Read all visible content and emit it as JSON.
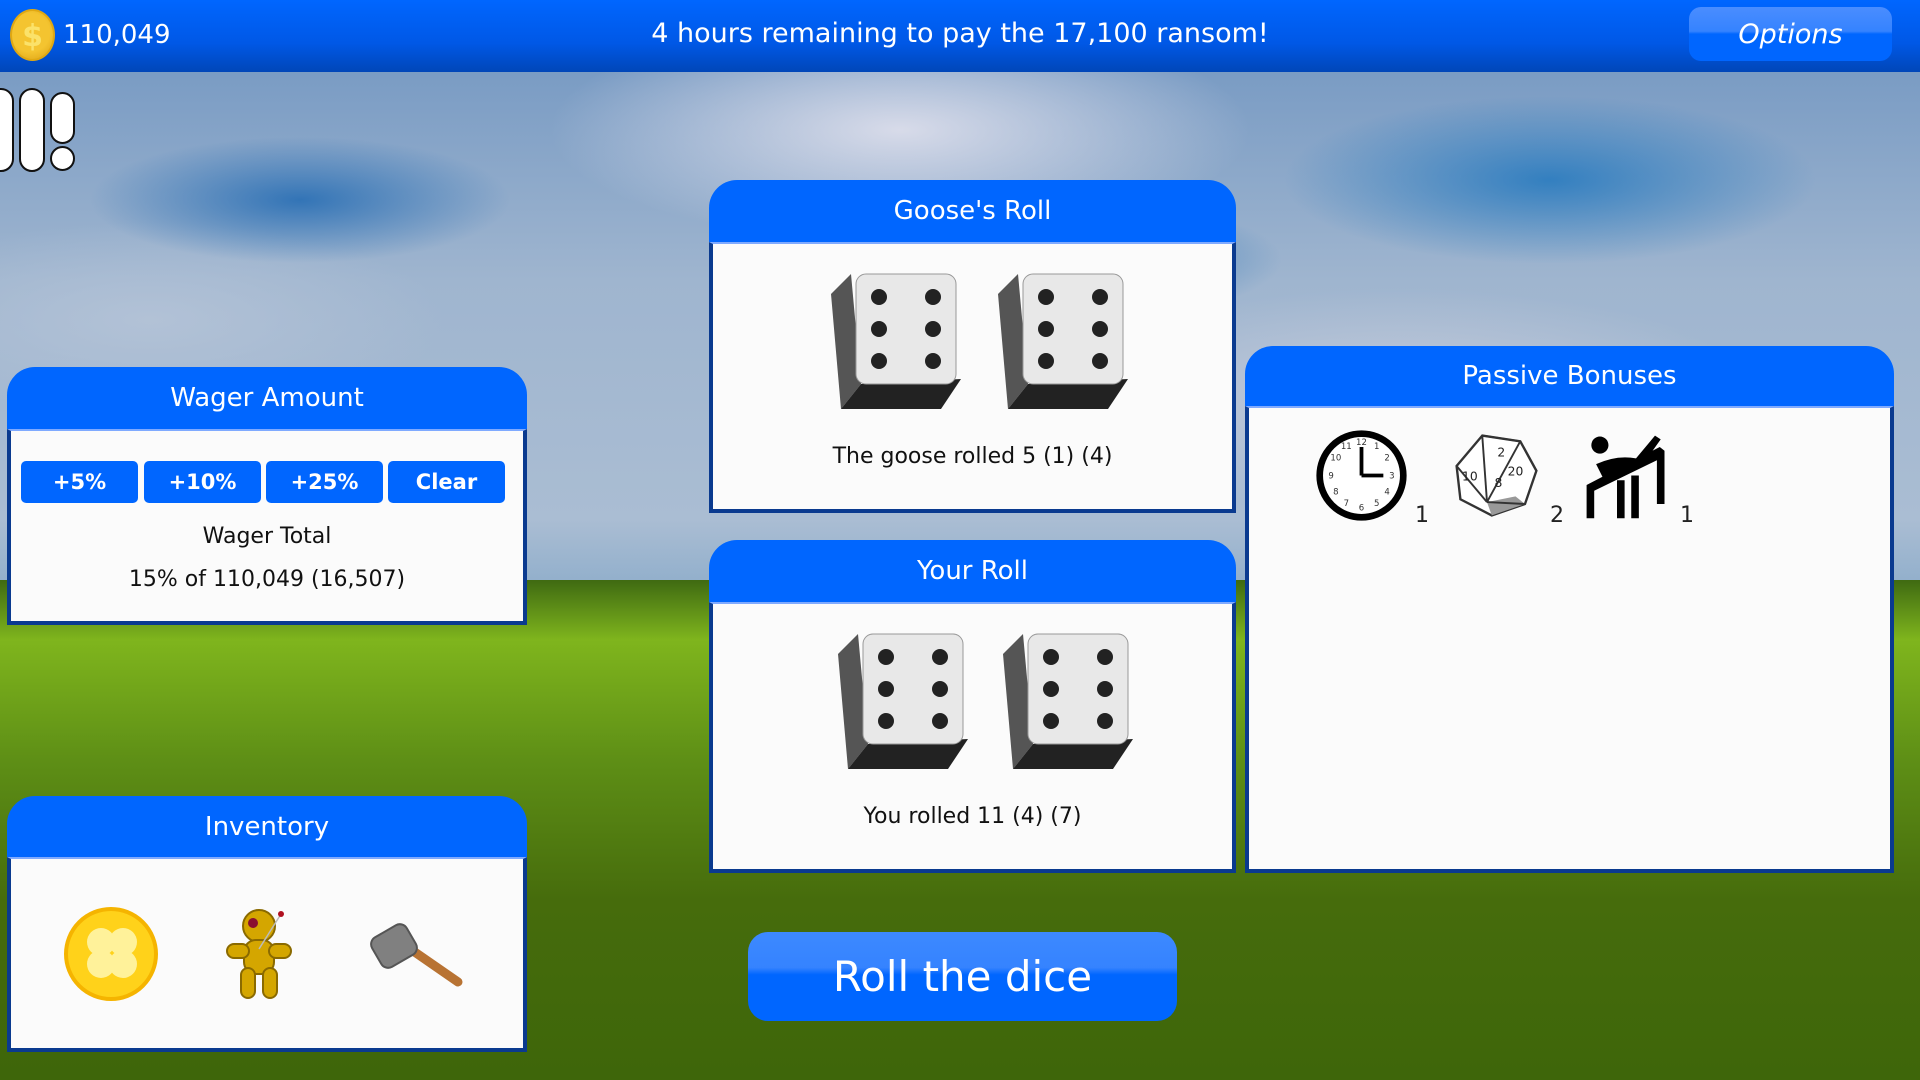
{
  "topbar": {
    "coins": "110,049",
    "coin_icon": "gold-coin-icon",
    "ransom_message": "4 hours remaining to pay the 17,100 ransom!",
    "options_label": "Options"
  },
  "lives": {
    "icon": "lives-indicator-icon"
  },
  "wager": {
    "title": "Wager Amount",
    "buttons": [
      "+5%",
      "+10%",
      "+25%",
      "Clear"
    ],
    "total_label": "Wager Total",
    "total_value": "15% of 110,049 (16,507)"
  },
  "inventory": {
    "title": "Inventory",
    "items": [
      {
        "name": "lucky-clover-coin",
        "icon": "clover-coin-icon"
      },
      {
        "name": "voodoo-doll",
        "icon": "voodoo-doll-icon"
      },
      {
        "name": "mallet",
        "icon": "mallet-icon"
      }
    ]
  },
  "goose_roll": {
    "title": "Goose's Roll",
    "dice_faces": [
      6,
      6
    ],
    "result_text": "The goose rolled 5 (1) (4)"
  },
  "your_roll": {
    "title": "Your Roll",
    "dice_faces": [
      6,
      6
    ],
    "result_text": "You rolled 11 (4) (7)"
  },
  "passive_bonuses": {
    "title": "Passive Bonuses",
    "items": [
      {
        "icon": "clock-icon",
        "count": "1"
      },
      {
        "icon": "d20-icon",
        "count": "2"
      },
      {
        "icon": "pool-player-icon",
        "count": "1"
      }
    ]
  },
  "roll_button": {
    "label": "Roll the dice"
  },
  "colors": {
    "primary_blue": "#0066ff",
    "panel_border": "#0a3a8f",
    "panel_body": "#fbfbfb"
  }
}
